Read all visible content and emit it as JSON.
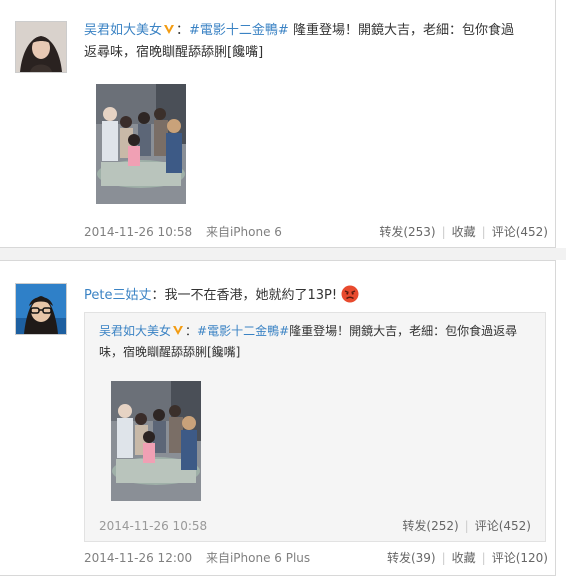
{
  "post1": {
    "author": "吴君如大美女",
    "colon": "：",
    "topic": "#電影十二金鴨#",
    "text_line1": " 隆重登場！開鏡大吉，老細：包你食過",
    "text_line2": "返尋味，宿晚瞓醒舔舔脷[饞嘴]",
    "time": "2014-11-26 10:58",
    "source": "来自iPhone 6",
    "repost": "转发(253)",
    "favorite": "收藏",
    "comment": "评论(452)"
  },
  "post2": {
    "author": "Pete三姑丈",
    "text": "：我一不在香港，她就約了13P!",
    "time": "2014-11-26 12:00",
    "source": "来自iPhone 6 Plus",
    "repost": "转发(39)",
    "favorite": "收藏",
    "comment": "评论(120)"
  },
  "repost": {
    "author": "吴君如大美女",
    "colon": "：",
    "topic": "#電影十二金鴨#",
    "text_line1": "隆重登場！開鏡大吉，老細：包你食過返尋",
    "text_line2": "味，宿晚瞓醒舔舔脷[饞嘴]",
    "time": "2014-11-26 10:58",
    "repost": "转发(252)",
    "comment": "评论(452)"
  },
  "colors": {
    "link": "#3b83c4",
    "meta": "#808080",
    "verified": "#f39c12"
  },
  "icons": {
    "verified": "verified-v-icon",
    "angry": "angry-face-emoji"
  }
}
